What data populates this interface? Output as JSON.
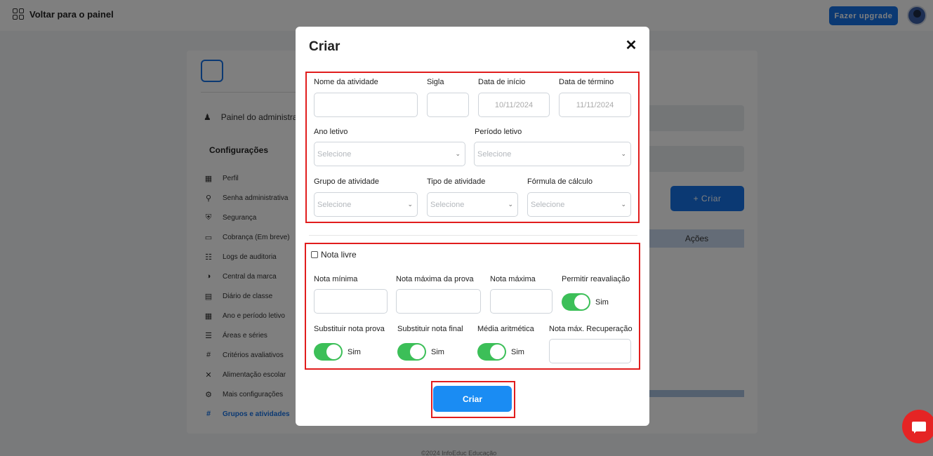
{
  "topbar": {
    "back_label": "Voltar para o painel",
    "upgrade_label": "Fazer upgrade"
  },
  "sidebar": {
    "admin_label": "Painel do administrador",
    "config_title": "Configurações",
    "items": [
      {
        "label": "Perfil",
        "icon": "building-icon"
      },
      {
        "label": "Senha administrativa",
        "icon": "key-icon"
      },
      {
        "label": "Segurança",
        "icon": "shield-icon"
      },
      {
        "label": "Cobrança (Em breve)",
        "icon": "card-icon"
      },
      {
        "label": "Logs de auditoria",
        "icon": "document-search-icon"
      },
      {
        "label": "Central da marca",
        "icon": "palette-icon"
      },
      {
        "label": "Diário de classe",
        "icon": "document-icon"
      },
      {
        "label": "Ano e período letivo",
        "icon": "calendar-icon"
      },
      {
        "label": "Áreas e séries",
        "icon": "list-icon"
      },
      {
        "label": "Critérios avaliativos",
        "icon": "hash-icon"
      },
      {
        "label": "Alimentação escolar",
        "icon": "utensils-icon"
      },
      {
        "label": "Mais configurações",
        "icon": "gear-icon"
      },
      {
        "label": "Grupos e atividades",
        "icon": "hash-icon"
      }
    ]
  },
  "background": {
    "create_label": "+ Criar",
    "actions_header": "Ações",
    "footer": "©2024 InfoEduc Educação"
  },
  "modal": {
    "title": "Criar",
    "close_icon": "close-icon",
    "fields": {
      "nome_label": "Nome da atividade",
      "sigla_label": "Sigla",
      "inicio_label": "Data de início",
      "inicio_value": "10/11/2024",
      "termino_label": "Data de término",
      "termino_value": "11/11/2024",
      "ano_label": "Ano letivo",
      "periodo_label": "Período letivo",
      "grupo_label": "Grupo de atividade",
      "tipo_label": "Tipo de atividade",
      "formula_label": "Fórmula de cálculo",
      "select_placeholder": "Selecione"
    },
    "grades": {
      "nota_livre_label": "Nota livre",
      "nota_minima_label": "Nota mínima",
      "nota_max_prova_label": "Nota máxima da prova",
      "nota_maxima_label": "Nota máxima",
      "permitir_label": "Permitir reavaliação",
      "substituir_prova_label": "Substituir nota prova",
      "substituir_final_label": "Substituir nota final",
      "media_label": "Média aritmética",
      "recuperacao_label": "Nota máx. Recuperação",
      "toggle_on_text": "Sim"
    },
    "submit_label": "Criar"
  },
  "colors": {
    "primary": "#1773e6",
    "toggle_on": "#3cbf58",
    "highlight": "#e11d1d"
  }
}
